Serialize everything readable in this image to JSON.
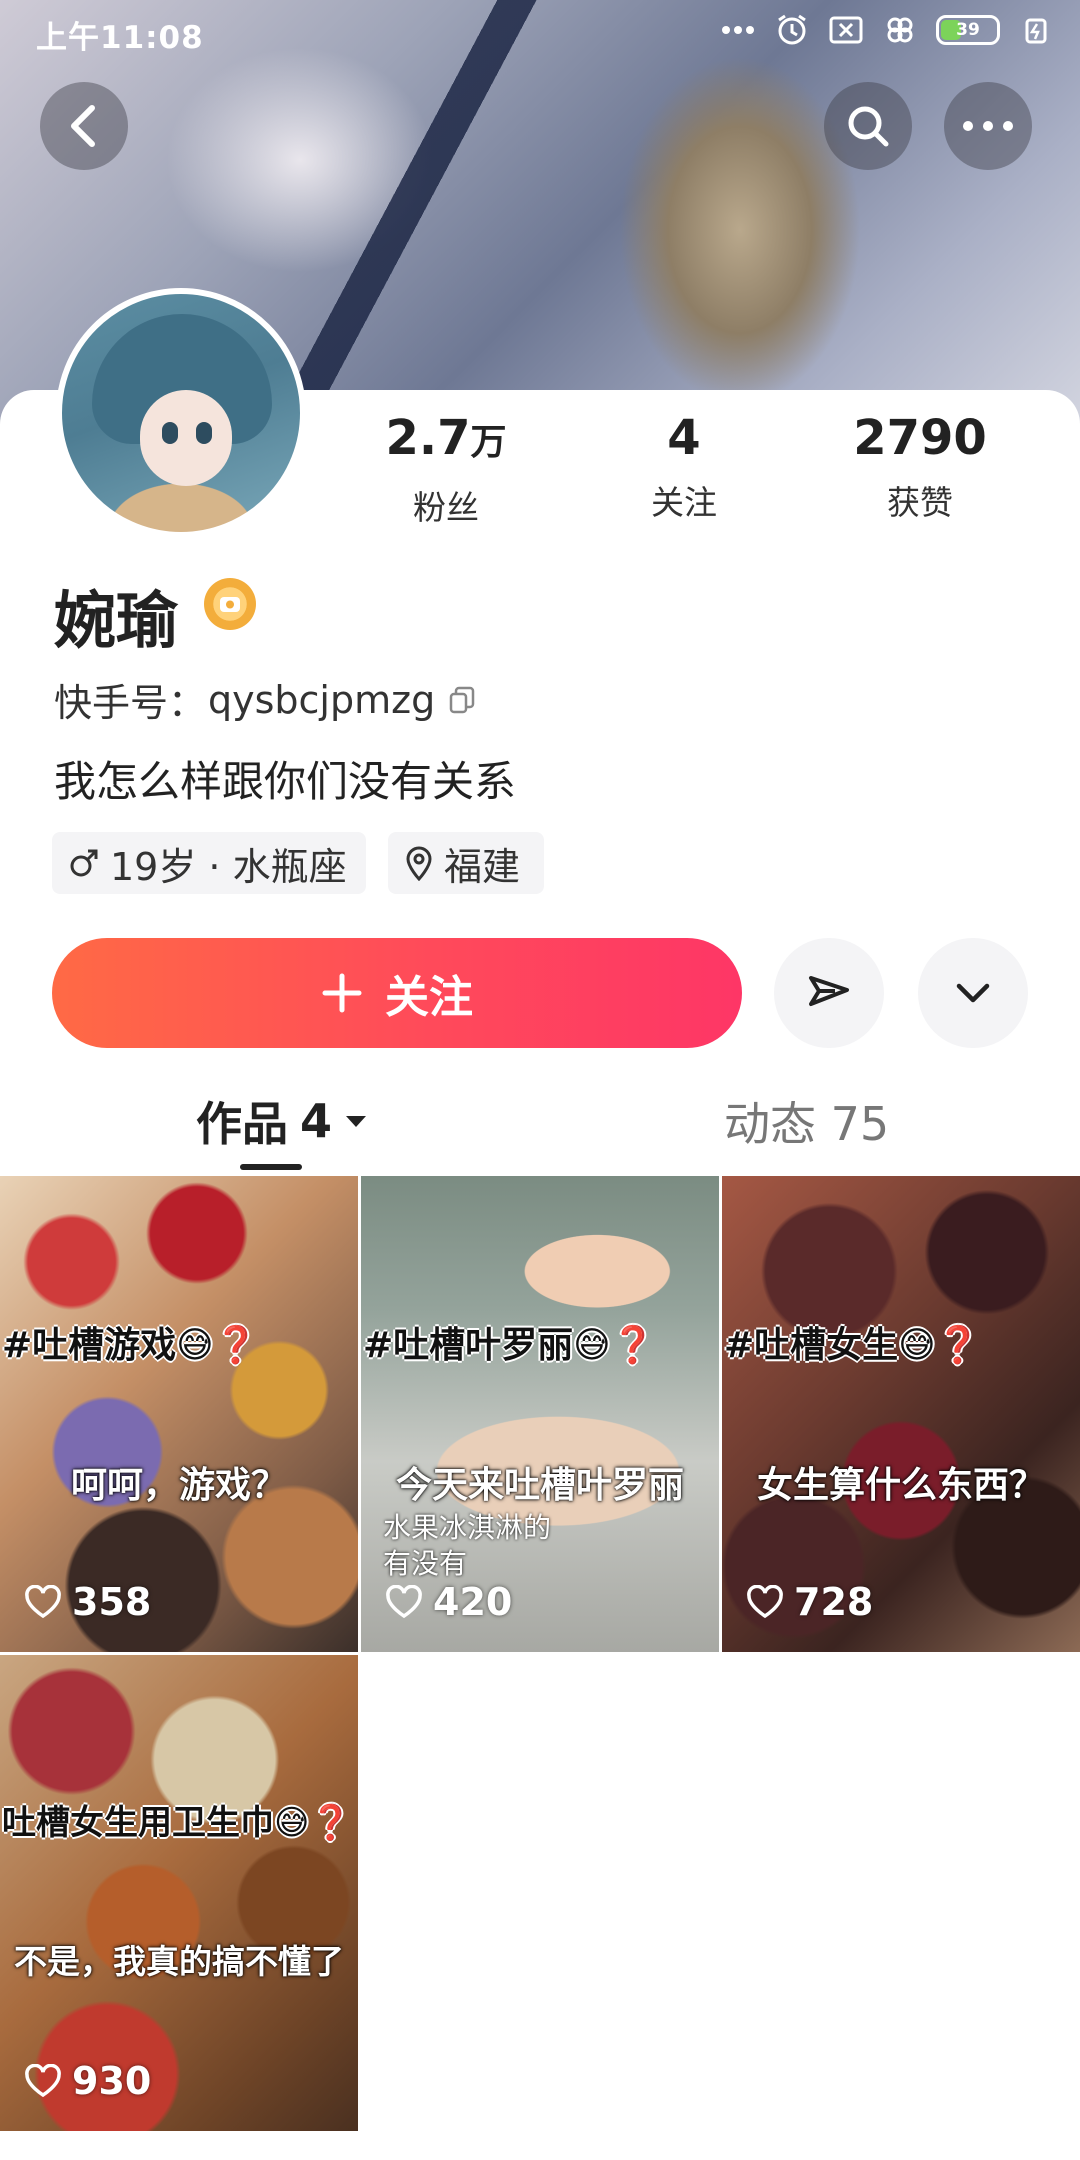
{
  "status_bar": {
    "time": "上午11:08",
    "battery": "39"
  },
  "header": {
    "icons": [
      "back-arrow-icon",
      "search-icon",
      "more-icon"
    ]
  },
  "profile": {
    "stats": [
      {
        "value": "2.7",
        "unit": "万",
        "label": "粉丝"
      },
      {
        "value": "4",
        "unit": "",
        "label": "关注"
      },
      {
        "value": "2790",
        "unit": "",
        "label": "获赞"
      }
    ],
    "name": "婉瑜",
    "kwai_id_label": "快手号：",
    "kwai_id": "qysbcjpmzg",
    "bio": "我怎么样跟你们没有关系",
    "tags": {
      "age": "19岁 · 水瓶座",
      "location": "福建"
    }
  },
  "actions": {
    "follow_label": "关注",
    "follow_color": "#fe4a55"
  },
  "tabs": {
    "works_label": "作品",
    "works_count": "4",
    "moments_label": "动态",
    "moments_count": "75"
  },
  "works": [
    {
      "title_overlay": "#吐槽游戏😅❓",
      "caption": "呵呵，游戏？",
      "extra": "",
      "likes": "358"
    },
    {
      "title_overlay": "#吐槽叶罗丽😅❓",
      "caption": "今天来吐槽叶罗丽",
      "extra": "水果冰淇淋的\n有没有",
      "likes": "420"
    },
    {
      "title_overlay": "#吐槽女生😅❓",
      "caption": "女生算什么东西？",
      "extra": "",
      "likes": "728"
    },
    {
      "title_overlay": "吐槽女生用卫生巾😅❓",
      "caption": "不是，我真的搞不懂了",
      "extra": "",
      "likes": "930"
    }
  ]
}
